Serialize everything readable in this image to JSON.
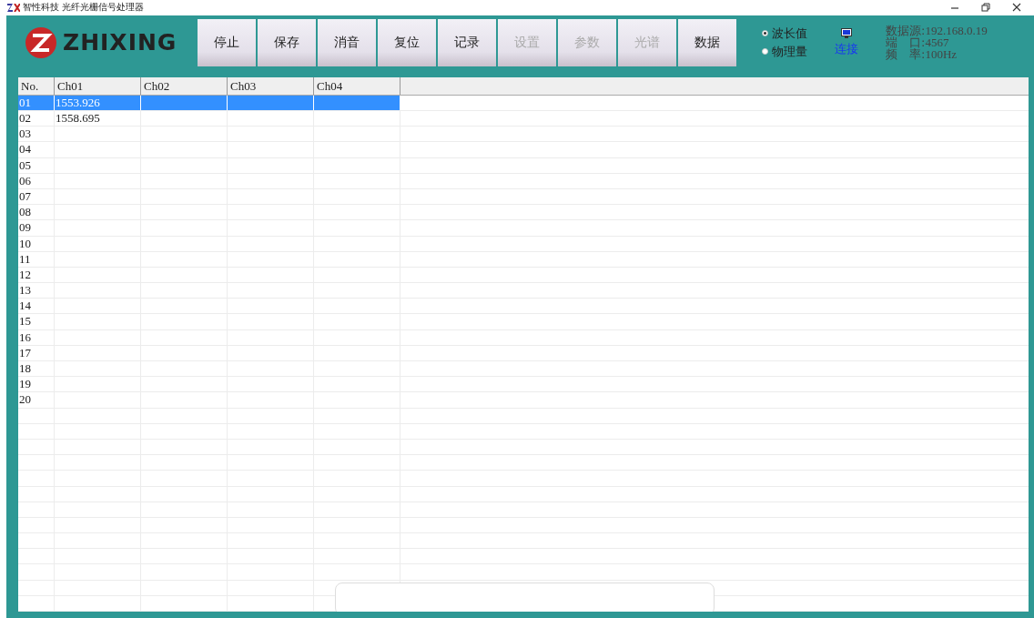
{
  "window": {
    "title": "智性科技 光纤光栅信号处理器"
  },
  "logo": {
    "text": "ZHIXING"
  },
  "toolbar": [
    {
      "label": "停止",
      "disabled": false
    },
    {
      "label": "保存",
      "disabled": false
    },
    {
      "label": "消音",
      "disabled": false
    },
    {
      "label": "复位",
      "disabled": false
    },
    {
      "label": "记录",
      "disabled": false
    },
    {
      "label": "设置",
      "disabled": true
    },
    {
      "label": "参数",
      "disabled": true
    },
    {
      "label": "光谱",
      "disabled": true
    },
    {
      "label": "数据",
      "disabled": false
    }
  ],
  "mode": [
    {
      "label": "波长值",
      "selected": true
    },
    {
      "label": "物理量",
      "selected": false
    }
  ],
  "connect": {
    "label": "连接"
  },
  "info": [
    {
      "label": "数据源:",
      "value": "192.168.0.19"
    },
    {
      "label": "端　口:",
      "value": "4567"
    },
    {
      "label": "频　率:",
      "value": "100Hz"
    }
  ],
  "table": {
    "columns": [
      "No.",
      "Ch01",
      "Ch02",
      "Ch03",
      "Ch04"
    ],
    "rows": [
      {
        "cells": [
          "01",
          "1553.926",
          "",
          "",
          ""
        ],
        "selected": true
      },
      {
        "cells": [
          "02",
          "1558.695",
          "",
          "",
          ""
        ],
        "selected": false
      },
      {
        "cells": [
          "03",
          "",
          "",
          "",
          ""
        ],
        "selected": false
      },
      {
        "cells": [
          "04",
          "",
          "",
          "",
          ""
        ],
        "selected": false
      },
      {
        "cells": [
          "05",
          "",
          "",
          "",
          ""
        ],
        "selected": false
      },
      {
        "cells": [
          "06",
          "",
          "",
          "",
          ""
        ],
        "selected": false
      },
      {
        "cells": [
          "07",
          "",
          "",
          "",
          ""
        ],
        "selected": false
      },
      {
        "cells": [
          "08",
          "",
          "",
          "",
          ""
        ],
        "selected": false
      },
      {
        "cells": [
          "09",
          "",
          "",
          "",
          ""
        ],
        "selected": false
      },
      {
        "cells": [
          "10",
          "",
          "",
          "",
          ""
        ],
        "selected": false
      },
      {
        "cells": [
          "11",
          "",
          "",
          "",
          ""
        ],
        "selected": false
      },
      {
        "cells": [
          "12",
          "",
          "",
          "",
          ""
        ],
        "selected": false
      },
      {
        "cells": [
          "13",
          "",
          "",
          "",
          ""
        ],
        "selected": false
      },
      {
        "cells": [
          "14",
          "",
          "",
          "",
          ""
        ],
        "selected": false
      },
      {
        "cells": [
          "15",
          "",
          "",
          "",
          ""
        ],
        "selected": false
      },
      {
        "cells": [
          "16",
          "",
          "",
          "",
          ""
        ],
        "selected": false
      },
      {
        "cells": [
          "17",
          "",
          "",
          "",
          ""
        ],
        "selected": false
      },
      {
        "cells": [
          "18",
          "",
          "",
          "",
          ""
        ],
        "selected": false
      },
      {
        "cells": [
          "19",
          "",
          "",
          "",
          ""
        ],
        "selected": false
      },
      {
        "cells": [
          "20",
          "",
          "",
          "",
          ""
        ],
        "selected": false
      }
    ]
  }
}
